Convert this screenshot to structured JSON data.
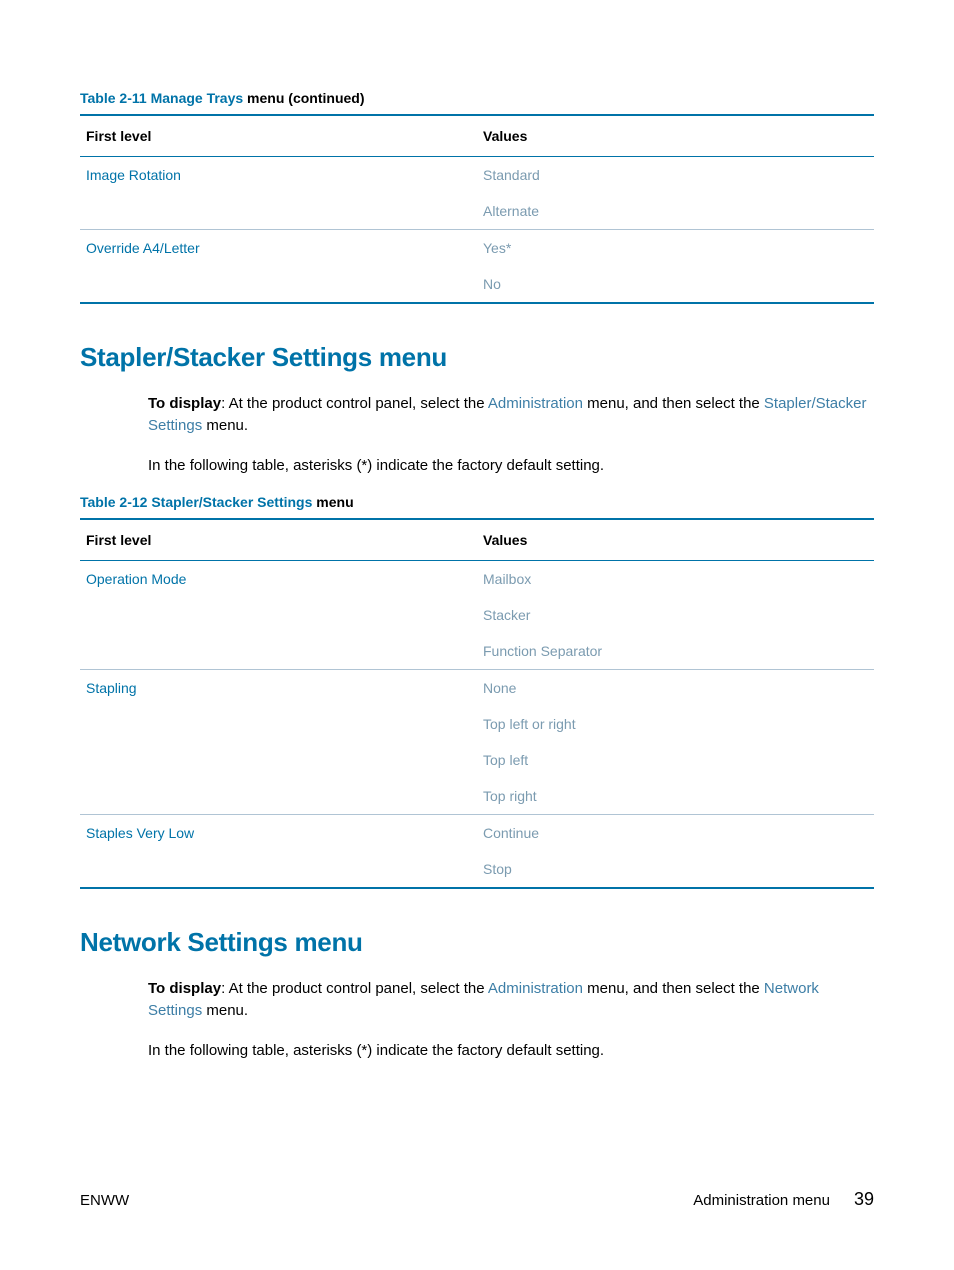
{
  "table1": {
    "caption_num": "Table 2-11",
    "caption_sub": "Manage Trays",
    "caption_suffix": " menu (continued)",
    "headers": {
      "c1": "First level",
      "c2": "Values"
    },
    "rows": [
      {
        "c1": "Image Rotation",
        "c2": "Standard",
        "group_top": false
      },
      {
        "c1": "",
        "c2": "Alternate",
        "group_top": false
      },
      {
        "c1": "Override A4/Letter",
        "c2": "Yes*",
        "group_top": true
      },
      {
        "c1": "",
        "c2": "No",
        "group_top": false,
        "last": true
      }
    ]
  },
  "section1": {
    "heading": "Stapler/Stacker Settings menu",
    "p1_a": "To display",
    "p1_b": ": At the product control panel, select the ",
    "p1_link1": "Administration",
    "p1_c": " menu, and then select the ",
    "p1_link2": "Stapler/Stacker Settings",
    "p1_d": " menu.",
    "p2": "In the following table, asterisks (*) indicate the factory default setting."
  },
  "table2": {
    "caption_num": "Table 2-12",
    "caption_sub": "Stapler/Stacker Settings",
    "caption_suffix": " menu",
    "headers": {
      "c1": "First level",
      "c2": "Values"
    },
    "rows": [
      {
        "c1": "Operation Mode",
        "c2": "Mailbox",
        "group_top": false
      },
      {
        "c1": "",
        "c2": "Stacker",
        "group_top": false
      },
      {
        "c1": "",
        "c2": "Function Separator",
        "group_top": false
      },
      {
        "c1": "Stapling",
        "c2": "None",
        "group_top": true
      },
      {
        "c1": "",
        "c2": "Top left or right",
        "group_top": false
      },
      {
        "c1": "",
        "c2": "Top left",
        "group_top": false
      },
      {
        "c1": "",
        "c2": "Top right",
        "group_top": false
      },
      {
        "c1": "Staples Very Low",
        "c2": "Continue",
        "group_top": true
      },
      {
        "c1": "",
        "c2": "Stop",
        "group_top": false,
        "last": true
      }
    ]
  },
  "section2": {
    "heading": "Network Settings menu",
    "p1_a": "To display",
    "p1_b": ": At the product control panel, select the ",
    "p1_link1": "Administration",
    "p1_c": " menu, and then select the ",
    "p1_link2": "Network Settings",
    "p1_d": " menu.",
    "p2": "In the following table, asterisks (*) indicate the factory default setting."
  },
  "footer": {
    "left": "ENWW",
    "right_text": "Administration menu",
    "page": "39"
  }
}
